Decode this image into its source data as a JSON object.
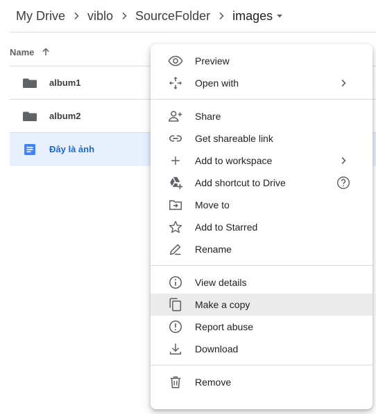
{
  "breadcrumb": {
    "items": [
      "My Drive",
      "viblo",
      "SourceFolder"
    ],
    "current": "images"
  },
  "file_list": {
    "column_name": "Name",
    "sort": "ascending",
    "rows": [
      {
        "name": "album1",
        "type": "folder",
        "selected": false
      },
      {
        "name": "album2",
        "type": "folder",
        "selected": false
      },
      {
        "name": "Đây là ảnh",
        "type": "document",
        "selected": true
      }
    ]
  },
  "context_menu": {
    "items": [
      {
        "label": "Preview",
        "icon": "eye-icon"
      },
      {
        "label": "Open with",
        "icon": "open-with-icon",
        "submenu": true
      },
      {
        "label": "Share",
        "icon": "person-add-icon"
      },
      {
        "label": "Get shareable link",
        "icon": "link-icon"
      },
      {
        "label": "Add to workspace",
        "icon": "plus-icon",
        "submenu": true
      },
      {
        "label": "Add shortcut to Drive",
        "icon": "drive-shortcut-icon",
        "help": true
      },
      {
        "label": "Move to",
        "icon": "move-to-folder-icon"
      },
      {
        "label": "Add to Starred",
        "icon": "star-icon"
      },
      {
        "label": "Rename",
        "icon": "pencil-icon"
      },
      {
        "label": "View details",
        "icon": "info-icon"
      },
      {
        "label": "Make a copy",
        "icon": "copy-icon",
        "highlighted": true
      },
      {
        "label": "Report abuse",
        "icon": "report-icon"
      },
      {
        "label": "Download",
        "icon": "download-icon"
      },
      {
        "label": "Remove",
        "icon": "trash-icon"
      }
    ]
  },
  "colors": {
    "selected_row_bg": "#e8f0fe",
    "selected_text": "#1967d2",
    "doc_icon": "#4285f4",
    "hover_bg": "#ebebeb"
  }
}
